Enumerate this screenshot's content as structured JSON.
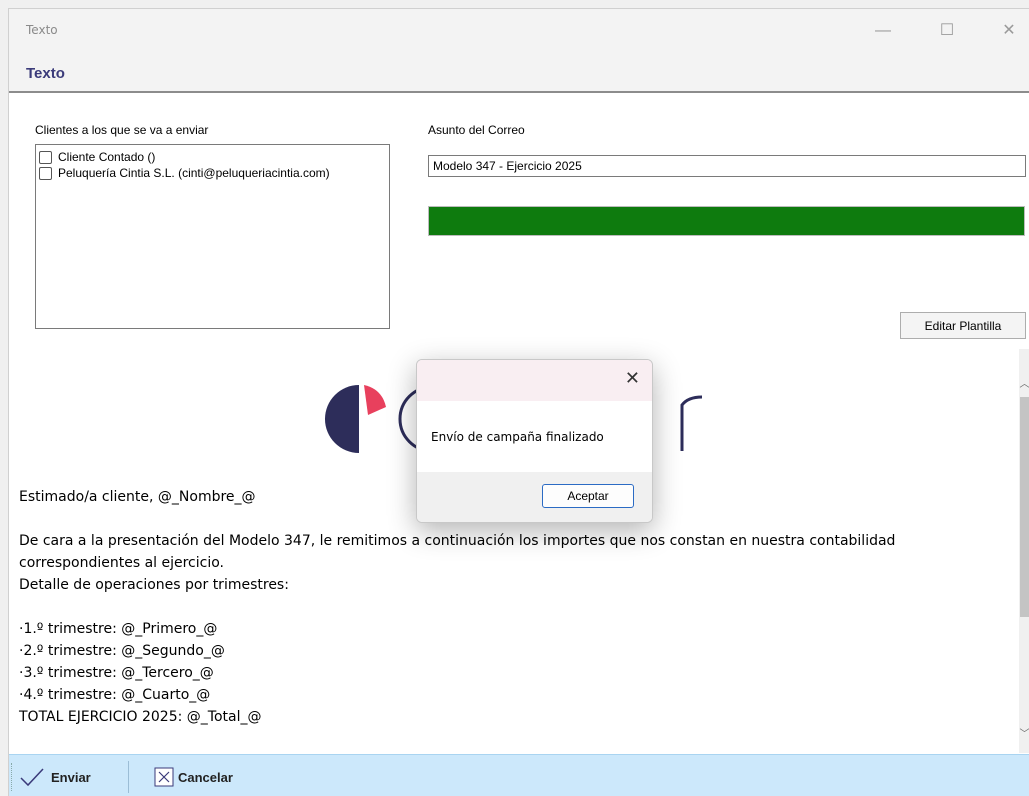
{
  "window": {
    "title": "Texto",
    "controls": {
      "minimize": "—",
      "maximize": "☐",
      "close": "✕"
    }
  },
  "header": {
    "title": "Texto"
  },
  "clients": {
    "label": "Clientes a los que se va a enviar",
    "items": [
      {
        "label": "Cliente Contado ()",
        "checked": false
      },
      {
        "label": "Peluquería Cintia S.L. (cinti@peluqueriacintia.com)",
        "checked": false
      }
    ]
  },
  "subject": {
    "label": "Asunto del Correo",
    "value": "Modelo 347 - Ejercicio 2025"
  },
  "progress": {
    "value": 1.0,
    "color": "#0e7b0e"
  },
  "edit_template_button": "Editar Plantilla",
  "preview": {
    "logo_text_visible": "C          r",
    "logo_colors": {
      "accent": "#e8405d",
      "dark": "#2d2d5a"
    },
    "lines": [
      "Estimado/a cliente, @_Nombre_@",
      "",
      "De cara a la presentación del Modelo 347, le remitimos a continuación los importes que nos constan en nuestra contabilidad",
      "correspondientes al ejercicio.",
      "Detalle de operaciones por trimestres:",
      "",
      "·1.º trimestre: @_Primero_@",
      "·2.º trimestre: @_Segundo_@",
      "·3.º trimestre: @_Tercero_@",
      "·4.º trimestre: @_Cuarto_@",
      "TOTAL EJERCICIO 2025: @_Total_@"
    ]
  },
  "toolbar": {
    "send_label": "Enviar",
    "cancel_label": "Cancelar",
    "background": "#cce8fb"
  },
  "modal": {
    "message": "Envío de campaña finalizado",
    "ok_label": "Aceptar",
    "close_icon": "✕"
  }
}
